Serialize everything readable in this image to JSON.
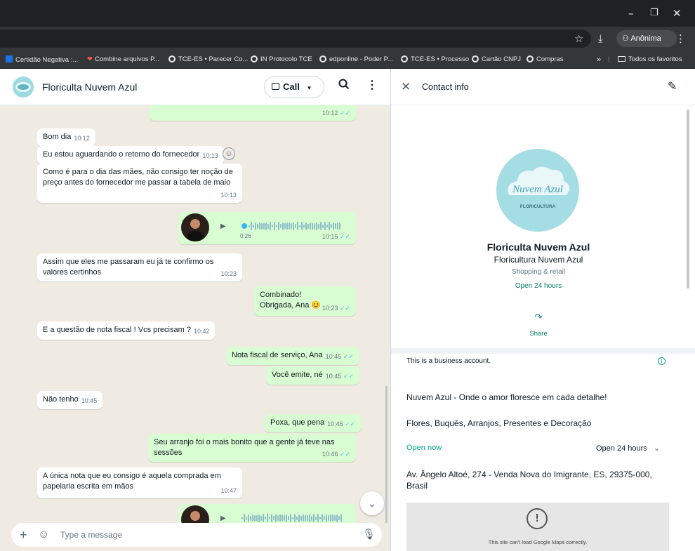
{
  "window": {
    "minimize": "–",
    "restore": "❐",
    "close": "✕"
  },
  "toolbar": {
    "star_icon": "☆",
    "download_icon": "⤓",
    "profile_label": "Anônima",
    "menu_icon": "⋮"
  },
  "bookmarks": {
    "items": [
      {
        "label": "Certidão Negativa :..."
      },
      {
        "label": "Combine arquivos P..."
      },
      {
        "label": "TCE-ES • Parecer Co..."
      },
      {
        "label": "IN Protocolo TCE"
      },
      {
        "label": "edponline - Poder P..."
      },
      {
        "label": "TCE-ES • Processo"
      },
      {
        "label": "Cartão CNPJ"
      },
      {
        "label": "Compras"
      }
    ],
    "overflow": "»",
    "all_label": "Todos os favoritos"
  },
  "chat": {
    "name": "Floriculta Nuvem Azul",
    "call_label": "Call",
    "messages": [
      {
        "dir": "out",
        "text": "",
        "time": "10:12"
      },
      {
        "dir": "in",
        "text": "Bom dia",
        "time": "10:12"
      },
      {
        "dir": "in",
        "text": "Eu estou aguardando o retorno do fornecedor",
        "time": "10:13"
      },
      {
        "dir": "in",
        "text": "Como é para o dia das mães, não consigo ter noção de preço antes do fornecedor me passar a tabela de maio",
        "time": "10:13"
      },
      {
        "dir": "out",
        "type": "audio",
        "duration": "0:26",
        "time": "10:15"
      },
      {
        "dir": "in",
        "text": "Assim que eles me passaram eu já te confirmo os valores certinhos",
        "time": "10:23"
      },
      {
        "dir": "out",
        "text": "Combinado! Obrigada, Ana 😊",
        "time": "10:23"
      },
      {
        "dir": "in",
        "text": "E a questão de nota fiscal ! Vcs precisam ?",
        "time": "10:42"
      },
      {
        "dir": "out",
        "text": "Nota fiscal de serviço, Ana",
        "time": "10:45"
      },
      {
        "dir": "out",
        "text": "Você emite, né",
        "time": "10:45"
      },
      {
        "dir": "in",
        "text": "Não tenho",
        "time": "10:45"
      },
      {
        "dir": "out",
        "text": "Poxa, que pena",
        "time": "10:46"
      },
      {
        "dir": "out",
        "text": "Seu arranjo foi o mais bonito que a gente já teve nas sessões",
        "time": "10:46"
      },
      {
        "dir": "in",
        "text": "A única nota que eu consigo é aquela comprada em papelaria escrita em mãos",
        "time": "10:47"
      },
      {
        "dir": "out",
        "type": "audio",
        "duration": "",
        "time": ""
      }
    ],
    "composer_placeholder": "Type a message"
  },
  "contact": {
    "title": "Contact info",
    "logo_text": "Nuvem Azul",
    "logo_sub": "FLORICULTURA",
    "name": "Floriculta Nuvem Azul",
    "business_name": "Floricultura Nuvem Azul",
    "category": "Shopping & retail",
    "hours_status": "Open 24 hours",
    "share_label": "Share",
    "business_note": "This is a business account.",
    "description": "Nuvem Azul - Onde o amor floresce em cada detalhe!",
    "tagline": "Flores, Buquês, Arranjos, Presentes e Decoração",
    "open_now": "Open now",
    "hours_value": "Open 24 hours",
    "address": "Av. Ângelo Altoé, 274 - Venda Nova do Imigrante, ES, 29375-000, Brasil",
    "map_error": "This site can't load Google Maps correctly."
  }
}
